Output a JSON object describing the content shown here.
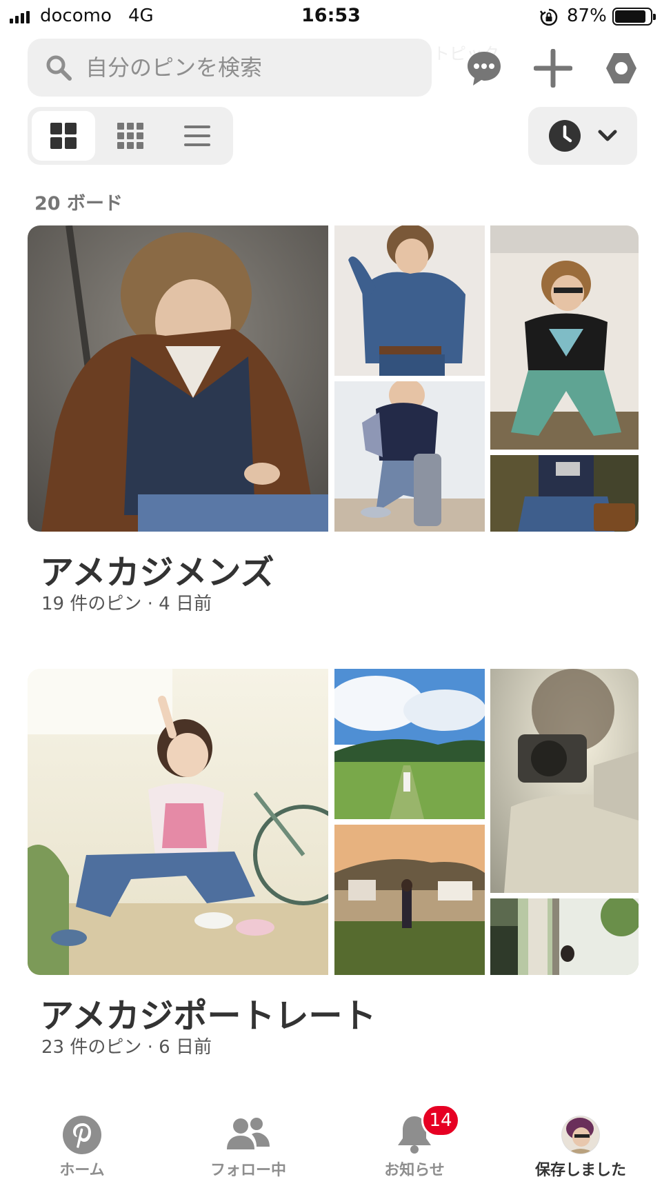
{
  "status_bar": {
    "carrier": "docomo",
    "network": "4G",
    "time": "16:53",
    "battery_percent": "87%",
    "battery_level": 0.87,
    "icons": [
      "signal-icon",
      "rotation-lock-icon",
      "battery-icon"
    ]
  },
  "header": {
    "search_placeholder": "自分のピンを検索",
    "icons": [
      "search-icon",
      "messages-icon",
      "plus-icon",
      "settings-icon"
    ]
  },
  "view_toggle": {
    "options": [
      "default-grid-icon",
      "compact-grid-icon",
      "list-icon"
    ],
    "active_index": 0
  },
  "sort": {
    "icons": [
      "clock-icon",
      "chevron-down-icon"
    ]
  },
  "board_count": "20 ボード",
  "boards": [
    {
      "title": "アメカジメンズ",
      "meta": "19 件のピン · 4 日前"
    },
    {
      "title": "アメカジポートレート",
      "meta": "23 件のピン · 6 日前"
    }
  ],
  "tab_bar": {
    "tabs": [
      {
        "label": "ホーム",
        "icon": "pinterest-icon"
      },
      {
        "label": "フォロー中",
        "icon": "people-icon"
      },
      {
        "label": "お知らせ",
        "icon": "bell-icon",
        "badge": "14"
      },
      {
        "label": "保存しました",
        "icon": "avatar"
      }
    ],
    "active_index": 3
  },
  "colors": {
    "brand_red": "#e60023",
    "text_primary": "#333333",
    "text_secondary": "#767676",
    "pill_background": "#efefef"
  }
}
